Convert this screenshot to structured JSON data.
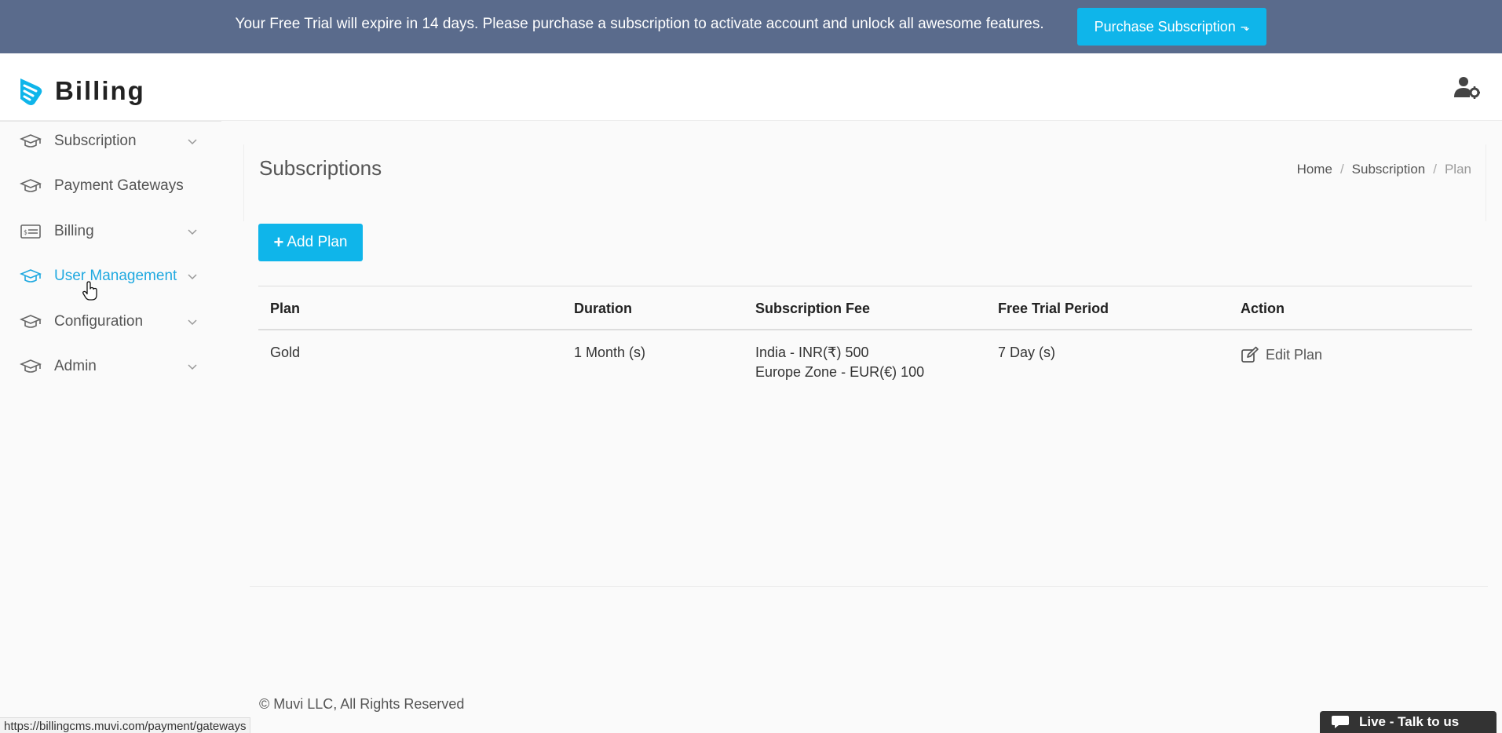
{
  "topbar": {
    "message": "Your Free Trial will expire in 14 days. Please purchase a subscription to activate account and unlock all awesome features.",
    "purchase_label": "Purchase Subscription"
  },
  "header": {
    "logo_text": "Billing"
  },
  "sidebar": {
    "items": [
      {
        "label": "Subscription",
        "icon": "graduation-cap-icon",
        "has_chevron": true
      },
      {
        "label": "Payment Gateways",
        "icon": "graduation-cap-icon",
        "has_chevron": false
      },
      {
        "label": "Billing",
        "icon": "invoice-icon",
        "has_chevron": true
      },
      {
        "label": "User Management",
        "icon": "graduation-cap-icon",
        "has_chevron": true,
        "active": true
      },
      {
        "label": "Configuration",
        "icon": "graduation-cap-icon",
        "has_chevron": true
      },
      {
        "label": "Admin",
        "icon": "graduation-cap-icon",
        "has_chevron": true
      }
    ]
  },
  "main": {
    "title": "Subscriptions",
    "breadcrumb": [
      "Home",
      "Subscription",
      "Plan"
    ],
    "add_label": "Add Plan",
    "table": {
      "headers": [
        "Plan",
        "Duration",
        "Subscription Fee",
        "Free Trial Period",
        "Action"
      ],
      "rows": [
        {
          "plan": "Gold",
          "duration": "1 Month (s)",
          "fee_lines": [
            "India - INR(₹) 500",
            "Europe Zone - EUR(€) 100"
          ],
          "trial": "7 Day (s)",
          "action": "Edit Plan"
        }
      ]
    }
  },
  "footer": {
    "copyright": "© Muvi LLC, All Rights Reserved"
  },
  "status_bar": {
    "url": "https://billingcms.muvi.com/payment/gateways"
  },
  "chat": {
    "label": "Live - Talk to us"
  },
  "colors": {
    "topbar": "#5a6b8c",
    "accent": "#0fb5ea",
    "active_link": "#20a9e0"
  }
}
